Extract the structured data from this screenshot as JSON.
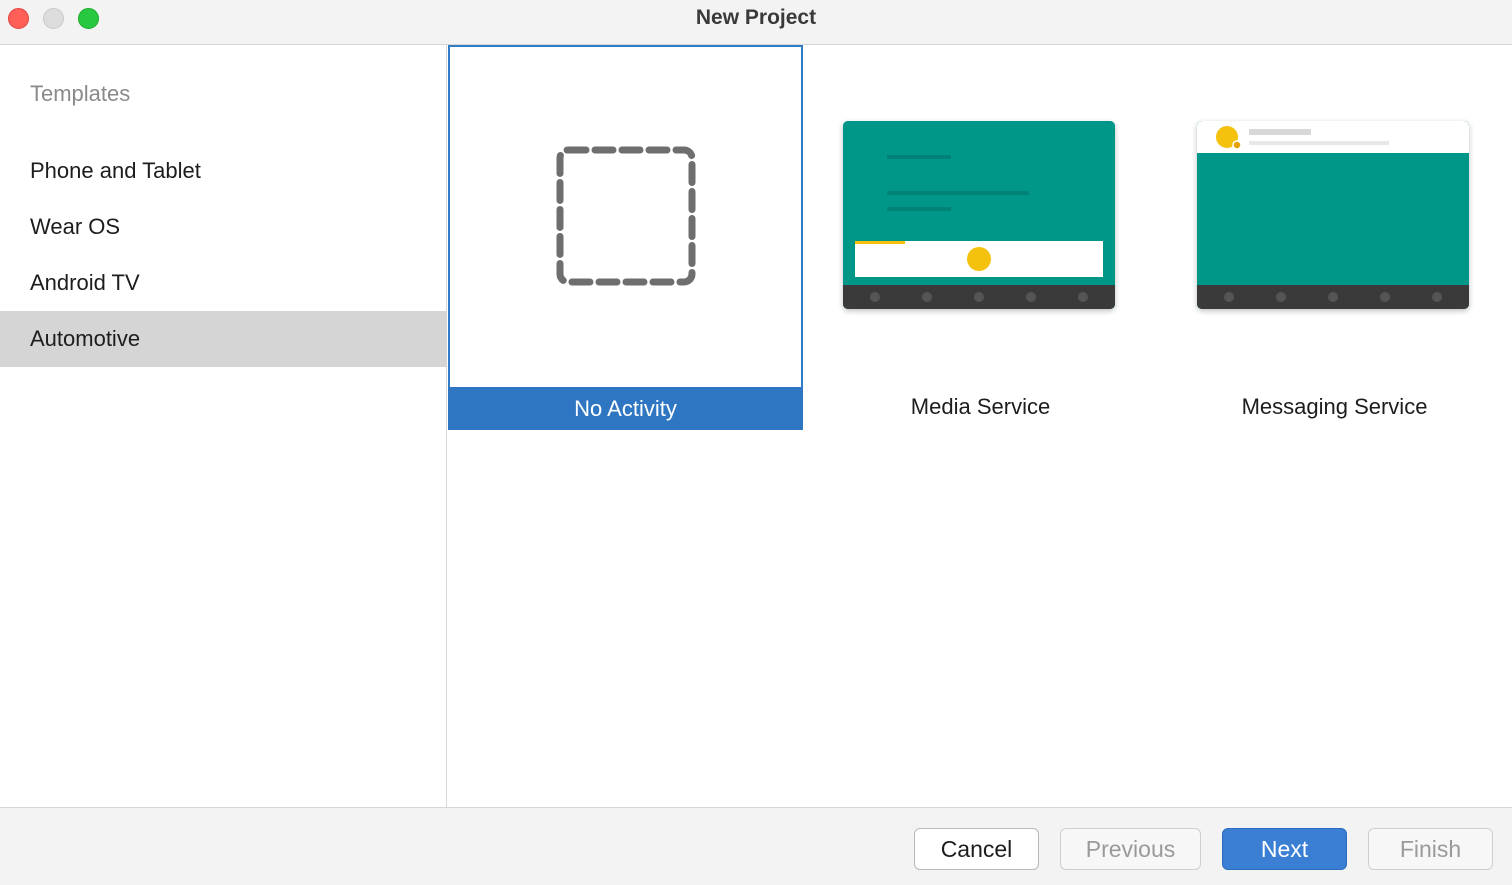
{
  "window": {
    "title": "New Project",
    "controls": [
      "close-icon",
      "minimize-icon",
      "maximize-icon"
    ]
  },
  "sidebar": {
    "heading": "Templates",
    "items": [
      {
        "label": "Phone and Tablet",
        "selected": false
      },
      {
        "label": "Wear OS",
        "selected": false
      },
      {
        "label": "Android TV",
        "selected": false
      },
      {
        "label": "Automotive",
        "selected": true
      }
    ]
  },
  "templates": [
    {
      "label": "No Activity",
      "selected": true,
      "icon": "dashed-square-icon"
    },
    {
      "label": "Media Service",
      "selected": false,
      "icon": "media-service-preview"
    },
    {
      "label": "Messaging Service",
      "selected": false,
      "icon": "messaging-service-preview"
    }
  ],
  "footer": {
    "cancel_label": "Cancel",
    "previous_label": "Previous",
    "next_label": "Next",
    "finish_label": "Finish"
  },
  "colors": {
    "accent": "#2e76c2",
    "teal": "#009688",
    "yellow": "#f4c20d",
    "dark_bar": "#3a3a3a",
    "selected_sidebar": "#d5d5d5"
  }
}
